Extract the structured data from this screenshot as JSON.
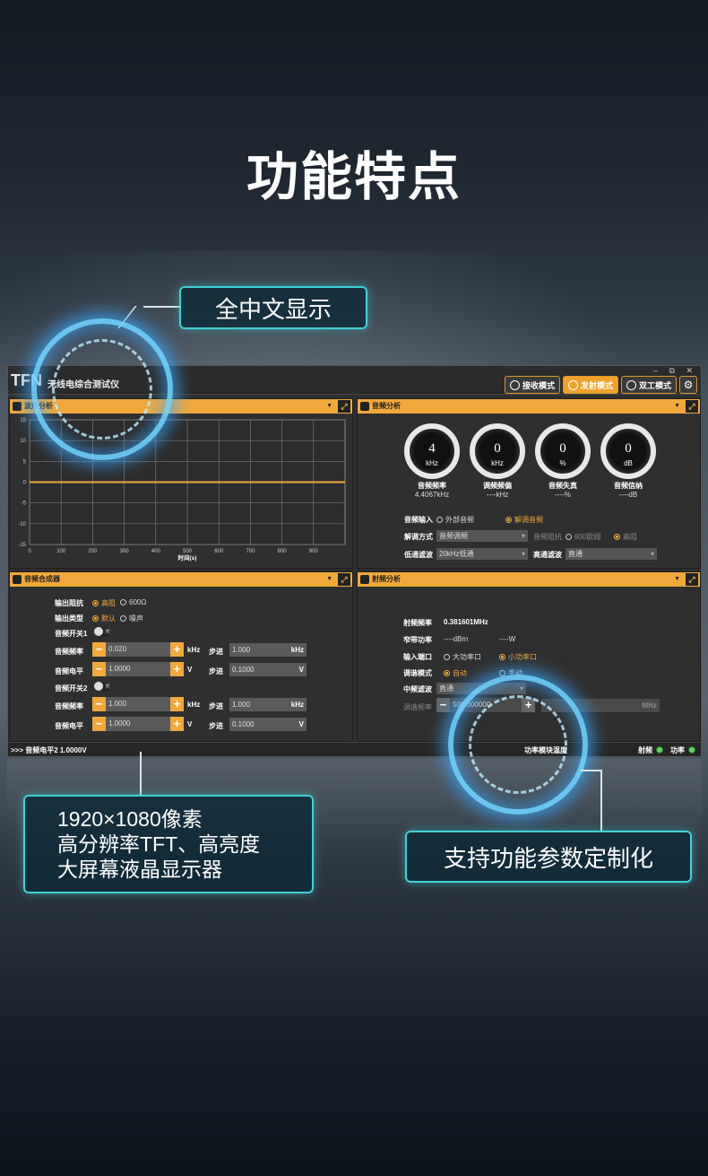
{
  "page": {
    "title": "功能特点",
    "badges": {
      "chinese": "全中文显示",
      "display_line1": "1920×1080像素",
      "display_line2": "高分辨率TFT、高亮度",
      "display_line3": "大屏幕液晶显示器",
      "custom": "支持功能参数定制化"
    }
  },
  "app": {
    "logo": "TFN",
    "title": "无线电综合测试仪",
    "window_controls": "–  ⧉  ✕",
    "modes": [
      {
        "label": "接收模式",
        "active": false
      },
      {
        "label": "发射模式",
        "active": true
      },
      {
        "label": "双工模式",
        "active": false
      }
    ],
    "settings_icon": "⚙",
    "waveform": {
      "header": "波形分析",
      "xlabel": "时间(s)"
    },
    "audio_analysis": {
      "header": "音频分析",
      "gauges": [
        {
          "value": "4",
          "unit": "kHz",
          "name": "音频频率",
          "reading": "4.4067kHz"
        },
        {
          "value": "0",
          "unit": "kHz",
          "name": "调频频偏",
          "reading": "----kHz"
        },
        {
          "value": "0",
          "unit": "%",
          "name": "音频失真",
          "reading": "----%"
        },
        {
          "value": "0",
          "unit": "dB",
          "name": "音频信纳",
          "reading": "----dB"
        }
      ],
      "audio_input_label": "音频输入",
      "audio_input_opt1": "外部音频",
      "audio_input_opt2": "解调音频",
      "demod_label": "解调方式",
      "demod_value": "音频调频",
      "impedance_label": "音频阻抗",
      "impedance_opt1": "600欧姆",
      "impedance_opt2": "高阻",
      "lowpass_label": "低通滤波",
      "lowpass_value": "20kHz低通",
      "highpass_label": "高通滤波",
      "highpass_value": "直通"
    },
    "synth": {
      "header": "音频合成器",
      "out_imp_label": "输出阻抗",
      "out_imp_opt1": "高阻",
      "out_imp_opt2": "600Ω",
      "out_type_label": "输出类型",
      "out_type_opt1": "默认",
      "out_type_opt2": "噪声",
      "switch1_label": "音频开关1",
      "switch2_label": "音频开关2",
      "switch_state": "关",
      "freq_label": "音频频率",
      "level_label": "音频电平",
      "step_label": "步进",
      "freq1": "0.020",
      "freq_step1": "1.000",
      "level1": "1.0000",
      "level_step1": "0.1000",
      "freq2": "1.000",
      "freq_step2": "1.000",
      "level2": "1.0000",
      "level_step2": "0.1000",
      "unit_khz": "kHz",
      "unit_v": "V"
    },
    "rf": {
      "header": "射频分析",
      "freq_label": "射频频率",
      "freq_value": "0.381601MHz",
      "narrow_label": "窄带功率",
      "narrow_dbm": "----dBm",
      "narrow_w": "----W",
      "port_label": "输入端口",
      "port_opt1": "大功率口",
      "port_opt2": "小功率口",
      "tune_label": "调谐模式",
      "tune_opt1": "自动",
      "tune_opt2": "手动",
      "if_label": "中频滤波",
      "if_value": "直通",
      "tune_freq_label": "调谐频率",
      "tune_freq_value": "500.000000",
      "tune_unit": "MHz"
    },
    "status": {
      "left": ">>> 音频电平2   1.0000V",
      "module_temp": "功率模块温度",
      "rf": "射频",
      "power": "功率"
    }
  },
  "chart_data": {
    "type": "line",
    "title": "",
    "xlabel": "时间(s)",
    "ylabel": "",
    "xlim": [
      0,
      1000
    ],
    "ylim": [
      -15,
      15
    ],
    "x_ticks": [
      0,
      100,
      200,
      300,
      400,
      500,
      600,
      700,
      800,
      900
    ],
    "y_ticks": [
      15,
      10,
      5,
      0,
      -5,
      -10,
      -15
    ],
    "grid": true,
    "series": [
      {
        "x": [
          0,
          1000
        ],
        "y": [
          0,
          0
        ],
        "color": "#f2a93b"
      }
    ]
  }
}
